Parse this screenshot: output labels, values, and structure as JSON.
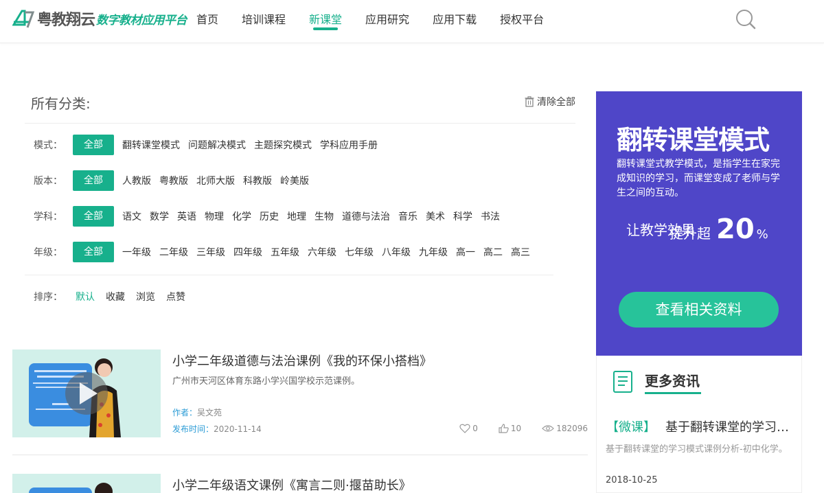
{
  "header": {
    "logo_name": "粤教翔云",
    "logo_sub": "数字教材应用平台",
    "nav": [
      "首页",
      "培训课程",
      "新课堂",
      "应用研究",
      "应用下载",
      "授权平台"
    ],
    "active_nav": "新课堂"
  },
  "filter": {
    "title": "所有分类:",
    "clear_all": "清除全部",
    "all_label": "全部",
    "rows": [
      {
        "label": "模式：",
        "options": [
          "翻转课堂模式",
          "问题解决模式",
          "主题探究模式",
          "学科应用手册"
        ]
      },
      {
        "label": "版本：",
        "options": [
          "人教版",
          "粤教版",
          "北师大版",
          "科教版",
          "岭美版"
        ]
      },
      {
        "label": "学科：",
        "options": [
          "语文",
          "数学",
          "英语",
          "物理",
          "化学",
          "历史",
          "地理",
          "生物",
          "道德与法治",
          "音乐",
          "美术",
          "科学",
          "书法"
        ]
      },
      {
        "label": "年级：",
        "options": [
          "一年级",
          "二年级",
          "三年级",
          "四年级",
          "五年级",
          "六年级",
          "七年级",
          "八年级",
          "九年级",
          "高一",
          "高二",
          "高三"
        ]
      }
    ],
    "sort": {
      "label": "排序：",
      "options": [
        "默认",
        "收藏",
        "浏览",
        "点赞"
      ],
      "active": "默认"
    }
  },
  "courses": [
    {
      "title": "小学二年级道德与法治课例《我的环保小搭档》",
      "desc": "广州市天河区体育东路小学兴国学校示范课例。",
      "author_label": "作者：",
      "author": "吴文苑",
      "date_label": "发布时间：",
      "date": "2020-11-14",
      "favorites": "0",
      "likes": "10",
      "views": "182096"
    },
    {
      "title": "小学二年级语文课例《寓言二则·揠苗助长》"
    }
  ],
  "banner": {
    "headline": "翻转课堂模式",
    "text": "翻转课堂式教学模式，是指学生在家完成知识的学习，而课堂变成了老师与学生之间的互动。",
    "line1": "让教学效果",
    "line2": "提升超",
    "big": "20",
    "unit": "%",
    "button": "查看相关资料"
  },
  "news": {
    "title": "更多资讯",
    "item": {
      "tag": "【微课】",
      "title": "基于翻转课堂的学习模式课例分析-初中化学",
      "desc": "基于翻转课堂的学习模式课例分析-初中化学。",
      "date": "2018-10-25"
    }
  },
  "colors": {
    "accent": "#17b08c",
    "banner": "#4f46c8",
    "button": "#27c39a",
    "meta_blue": "#2c9cd6"
  }
}
